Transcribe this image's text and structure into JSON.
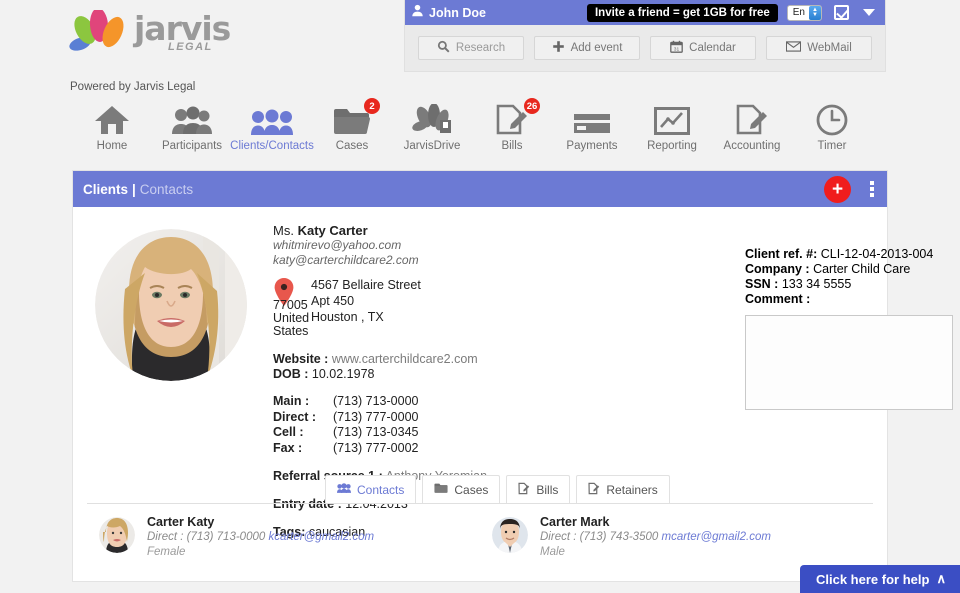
{
  "brand": {
    "name": "jarvis",
    "sub": "LEGAL",
    "powered_by": "Powered by Jarvis Legal",
    "accent": "#6c7ad4",
    "logo_colors": [
      "#5a7fd4",
      "#8cc63f",
      "#e0457b",
      "#f5952a"
    ]
  },
  "header": {
    "user_name": "John Doe",
    "user_icon": "person-icon",
    "invite_banner": "Invite a friend = get 1GB for free",
    "language": "En",
    "checkbox_icon": "checkbox-checked-icon",
    "caret_icon": "caret-down-icon",
    "tools": [
      {
        "label": "Research",
        "icon": "magnifier-icon",
        "name": "research-button"
      },
      {
        "label": "Add event",
        "icon": "plus-icon",
        "name": "add-event-button"
      },
      {
        "label": "Calendar",
        "icon": "calendar-icon",
        "name": "calendar-button"
      },
      {
        "label": "WebMail",
        "icon": "envelope-icon",
        "name": "webmail-button"
      }
    ]
  },
  "nav": [
    {
      "label": "Home",
      "icon": "home-icon",
      "badge": "",
      "active": false
    },
    {
      "label": "Participants",
      "icon": "people-icon",
      "badge": "",
      "active": false
    },
    {
      "label": "Clients/Contacts",
      "icon": "contacts-icon",
      "badge": "",
      "active": true
    },
    {
      "label": "Cases",
      "icon": "folder-icon",
      "badge": "2",
      "active": false
    },
    {
      "label": "JarvisDrive",
      "icon": "drive-icon",
      "badge": "",
      "active": false
    },
    {
      "label": "Bills",
      "icon": "bill-icon",
      "badge": "26",
      "active": false
    },
    {
      "label": "Payments",
      "icon": "card-icon",
      "badge": "",
      "active": false
    },
    {
      "label": "Reporting",
      "icon": "chart-icon",
      "badge": "",
      "active": false
    },
    {
      "label": "Accounting",
      "icon": "ledger-icon",
      "badge": "",
      "active": false
    },
    {
      "label": "Timer",
      "icon": "clock-icon",
      "badge": "",
      "active": false
    }
  ],
  "panel": {
    "title_primary": "Clients",
    "title_separator": "|",
    "title_secondary": "Contacts",
    "add_label": "+",
    "menu_icon": "kebab-menu-icon"
  },
  "contact": {
    "photo_alt": "katy-carter-photo",
    "salutation": "Ms.",
    "full_name": "Katy Carter",
    "emails": [
      "whitmirevo@yahoo.com",
      "katy@carterchildcare2.com"
    ],
    "address": {
      "pin_icon": "map-pin-icon",
      "line1": "4567 Bellaire Street",
      "line2": "Apt 450",
      "line3": "Houston , TX",
      "zip": "77005",
      "country_line1": "United",
      "country_line2": "States"
    },
    "website_label": "Website :",
    "website": "www.carterchildcare2.com",
    "dob_label": "DOB :",
    "dob": "10.02.1978",
    "phones": [
      {
        "label": "Main :",
        "value": "(713) 713-0000"
      },
      {
        "label": "Direct :",
        "value": "(713) 777-0000"
      },
      {
        "label": "Cell :",
        "value": "(713) 713-0345"
      },
      {
        "label": "Fax :",
        "value": "(713) 777-0002"
      }
    ],
    "referral_label": "Referral source 1 :",
    "referral_value": "Anthony Yeremian",
    "entry_date_label": "Entry date :",
    "entry_date": "12.04.2013",
    "tags_label": "Tags:",
    "tags": "caucasian"
  },
  "client_meta": {
    "ref_label": "Client ref. #:",
    "ref_value": "CLI-12-04-2013-004",
    "company_label": "Company :",
    "company_value": "Carter Child Care",
    "ssn_label": "SSN :",
    "ssn_value": "133 34 5555",
    "comment_label": "Comment :",
    "comment_value": ""
  },
  "tabs": [
    {
      "label": "Contacts",
      "icon": "people-small-icon",
      "active": true
    },
    {
      "label": "Cases",
      "icon": "folder-small-icon",
      "active": false
    },
    {
      "label": "Bills",
      "icon": "bill-small-icon",
      "active": false
    },
    {
      "label": "Retainers",
      "icon": "retainer-small-icon",
      "active": false
    }
  ],
  "related_contacts": [
    {
      "avatar": "carter-katy-avatar",
      "name": "Carter Katy",
      "direct_label": "Direct :",
      "phone": "(713) 713-0000",
      "email": "kcarter@gmail2.com",
      "gender": "Female"
    },
    {
      "avatar": "carter-mark-avatar",
      "name": "Carter Mark",
      "direct_label": "Direct :",
      "phone": "(713) 743-3500",
      "email": "mcarter@gmail2.com",
      "gender": "Male"
    }
  ],
  "help": {
    "label": "Click here for help",
    "caret": "∧"
  }
}
